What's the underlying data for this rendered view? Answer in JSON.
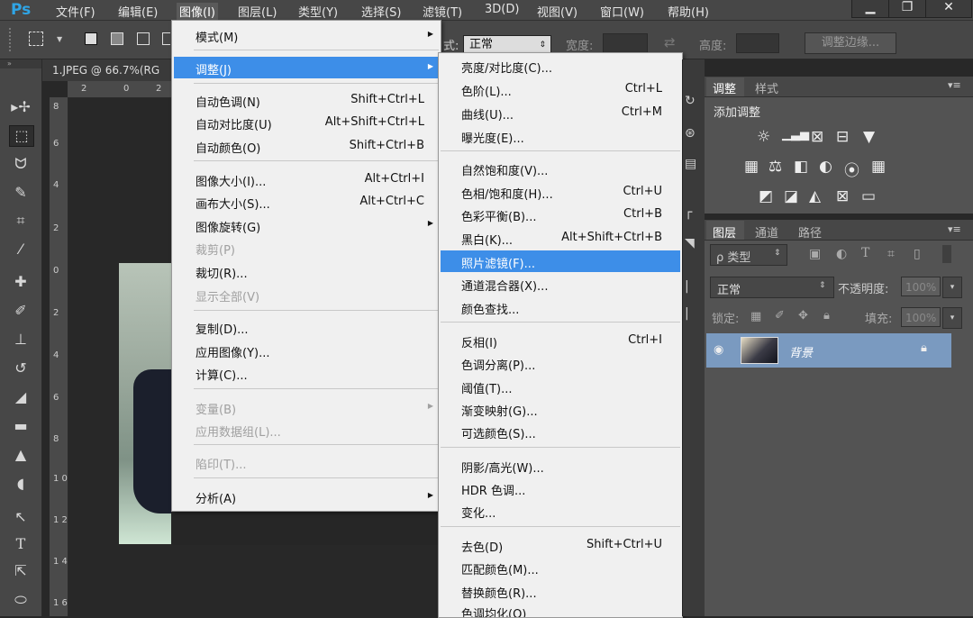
{
  "app": {
    "logo": "Ps"
  },
  "menubar": {
    "items": [
      "文件(F)",
      "编辑(E)",
      "图像(I)",
      "图层(L)",
      "类型(Y)",
      "选择(S)",
      "滤镜(T)",
      "3D(D)",
      "视图(V)",
      "窗口(W)",
      "帮助(H)"
    ],
    "active": "图像(I)"
  },
  "window_buttons": {
    "minimize": "▁",
    "restore": "❐",
    "close": "✕"
  },
  "options_bar": {
    "style_label": "式:",
    "style_value": "正常",
    "width_label": "宽度:",
    "height_label": "高度:",
    "refine_edge": "调整边缘..."
  },
  "document": {
    "tab_title": "1.JPEG @ 66.7%(RG",
    "ruler_top": [
      "2",
      "0",
      "2"
    ],
    "ruler_left": [
      "8",
      "6",
      "4",
      "2",
      "0",
      "2",
      "4",
      "6",
      "8",
      "1 0",
      "1 2",
      "1 4",
      "1 6"
    ]
  },
  "image_menu": {
    "items": [
      {
        "label": "模式(M)",
        "shortcut": "",
        "submenu": true,
        "disabled": false
      },
      {
        "label": "调整(J)",
        "shortcut": "",
        "submenu": true,
        "disabled": false,
        "highlighted": true
      },
      {
        "label": "自动色调(N)",
        "shortcut": "Shift+Ctrl+L",
        "disabled": false
      },
      {
        "label": "自动对比度(U)",
        "shortcut": "Alt+Shift+Ctrl+L",
        "disabled": false
      },
      {
        "label": "自动颜色(O)",
        "shortcut": "Shift+Ctrl+B",
        "disabled": false
      },
      {
        "label": "图像大小(I)...",
        "shortcut": "Alt+Ctrl+I",
        "disabled": false
      },
      {
        "label": "画布大小(S)...",
        "shortcut": "Alt+Ctrl+C",
        "disabled": false
      },
      {
        "label": "图像旋转(G)",
        "shortcut": "",
        "submenu": true,
        "disabled": false
      },
      {
        "label": "裁剪(P)",
        "shortcut": "",
        "disabled": true
      },
      {
        "label": "裁切(R)...",
        "shortcut": "",
        "disabled": false
      },
      {
        "label": "显示全部(V)",
        "shortcut": "",
        "disabled": true
      },
      {
        "label": "复制(D)...",
        "shortcut": "",
        "disabled": false
      },
      {
        "label": "应用图像(Y)...",
        "shortcut": "",
        "disabled": false
      },
      {
        "label": "计算(C)...",
        "shortcut": "",
        "disabled": false
      },
      {
        "label": "变量(B)",
        "shortcut": "",
        "submenu": true,
        "disabled": true
      },
      {
        "label": "应用数据组(L)...",
        "shortcut": "",
        "disabled": true
      },
      {
        "label": "陷印(T)...",
        "shortcut": "",
        "disabled": true
      },
      {
        "label": "分析(A)",
        "shortcut": "",
        "submenu": true,
        "disabled": false
      }
    ]
  },
  "adjust_submenu": {
    "items": [
      {
        "label": "亮度/对比度(C)...",
        "shortcut": ""
      },
      {
        "label": "色阶(L)...",
        "shortcut": "Ctrl+L"
      },
      {
        "label": "曲线(U)...",
        "shortcut": "Ctrl+M"
      },
      {
        "label": "曝光度(E)...",
        "shortcut": ""
      },
      {
        "label": "自然饱和度(V)...",
        "shortcut": ""
      },
      {
        "label": "色相/饱和度(H)...",
        "shortcut": "Ctrl+U"
      },
      {
        "label": "色彩平衡(B)...",
        "shortcut": "Ctrl+B"
      },
      {
        "label": "黑白(K)...",
        "shortcut": "Alt+Shift+Ctrl+B"
      },
      {
        "label": "照片滤镜(F)...",
        "shortcut": "",
        "highlighted": true
      },
      {
        "label": "通道混合器(X)...",
        "shortcut": ""
      },
      {
        "label": "颜色查找...",
        "shortcut": ""
      },
      {
        "label": "反相(I)",
        "shortcut": "Ctrl+I"
      },
      {
        "label": "色调分离(P)...",
        "shortcut": ""
      },
      {
        "label": "阈值(T)...",
        "shortcut": ""
      },
      {
        "label": "渐变映射(G)...",
        "shortcut": ""
      },
      {
        "label": "可选颜色(S)...",
        "shortcut": ""
      },
      {
        "label": "阴影/高光(W)...",
        "shortcut": ""
      },
      {
        "label": "HDR 色调...",
        "shortcut": ""
      },
      {
        "label": "变化...",
        "shortcut": ""
      },
      {
        "label": "去色(D)",
        "shortcut": "Shift+Ctrl+U"
      },
      {
        "label": "匹配颜色(M)...",
        "shortcut": ""
      },
      {
        "label": "替换颜色(R)...",
        "shortcut": ""
      },
      {
        "label": "色调均化(Q)",
        "shortcut": ""
      }
    ]
  },
  "adjust_panel": {
    "tabs": [
      "调整",
      "样式"
    ],
    "title": "添加调整"
  },
  "layers_panel": {
    "tabs": [
      "图层",
      "通道",
      "路径"
    ],
    "filter_label": "ρ 类型",
    "blend_mode": "正常",
    "opacity_label": "不透明度:",
    "opacity_value": "100%",
    "lock_label": "锁定:",
    "fill_label": "填充:",
    "fill_value": "100%",
    "layer_name": "背景"
  }
}
